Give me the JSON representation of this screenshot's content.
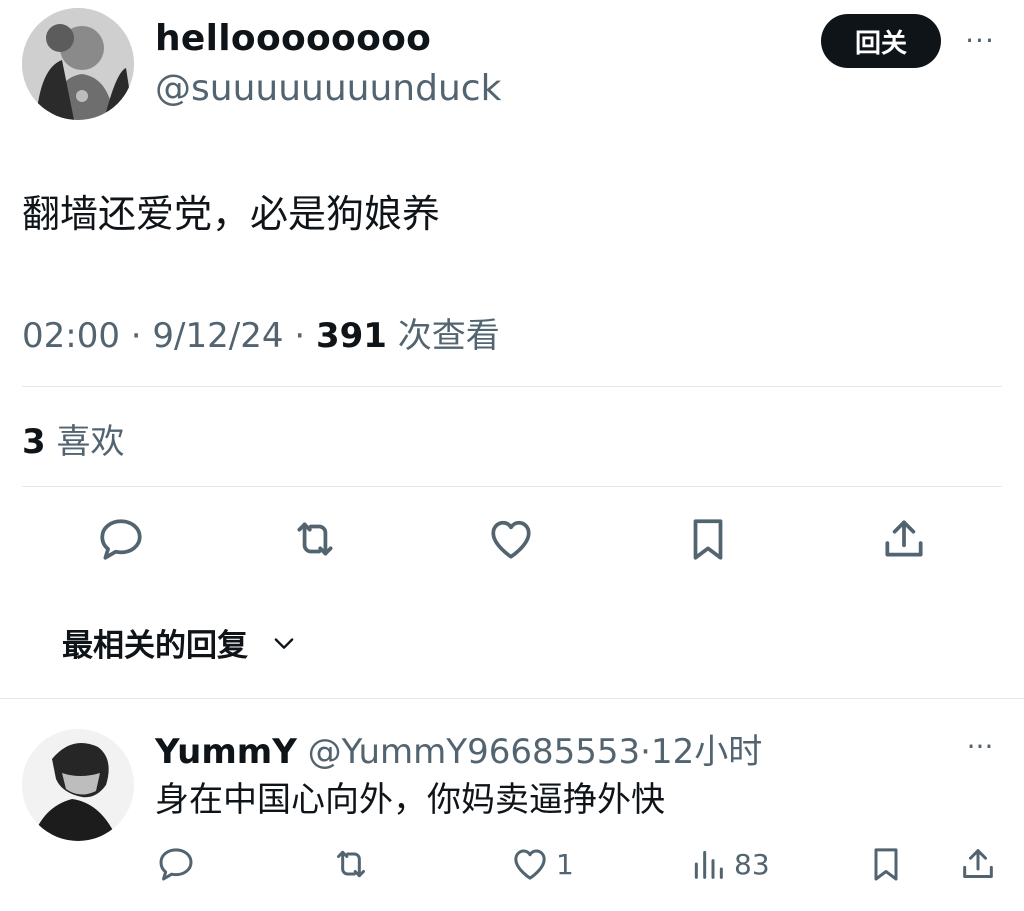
{
  "tweet": {
    "display_name": "helloooooooo",
    "handle": "@suuuuuuuunduck",
    "follow_label": "回关",
    "more_label": "···",
    "text": "翻墙还爱党，必是狗娘养",
    "time": "02:00",
    "date": "9/12/24",
    "sep": "·",
    "views_count": "391",
    "views_label": "次查看",
    "likes_count": "3",
    "likes_label": "喜欢"
  },
  "sort": {
    "label": "最相关的回复"
  },
  "reply": {
    "display_name": "YummY",
    "handle": "@YummY96685553",
    "sep": "·",
    "time": "12小时",
    "more_label": "···",
    "text": "身在中国心向外，你妈卖逼挣外快",
    "likes": "1",
    "views": "83"
  },
  "icons": [
    "reply-icon",
    "retweet-icon",
    "like-icon",
    "bookmark-icon",
    "share-icon",
    "views-icon",
    "chevron-down-icon"
  ],
  "colors": {
    "text": "#0f1419",
    "secondary": "#536471",
    "button_bg": "#0f1419",
    "divider": "#e6e8ea"
  }
}
